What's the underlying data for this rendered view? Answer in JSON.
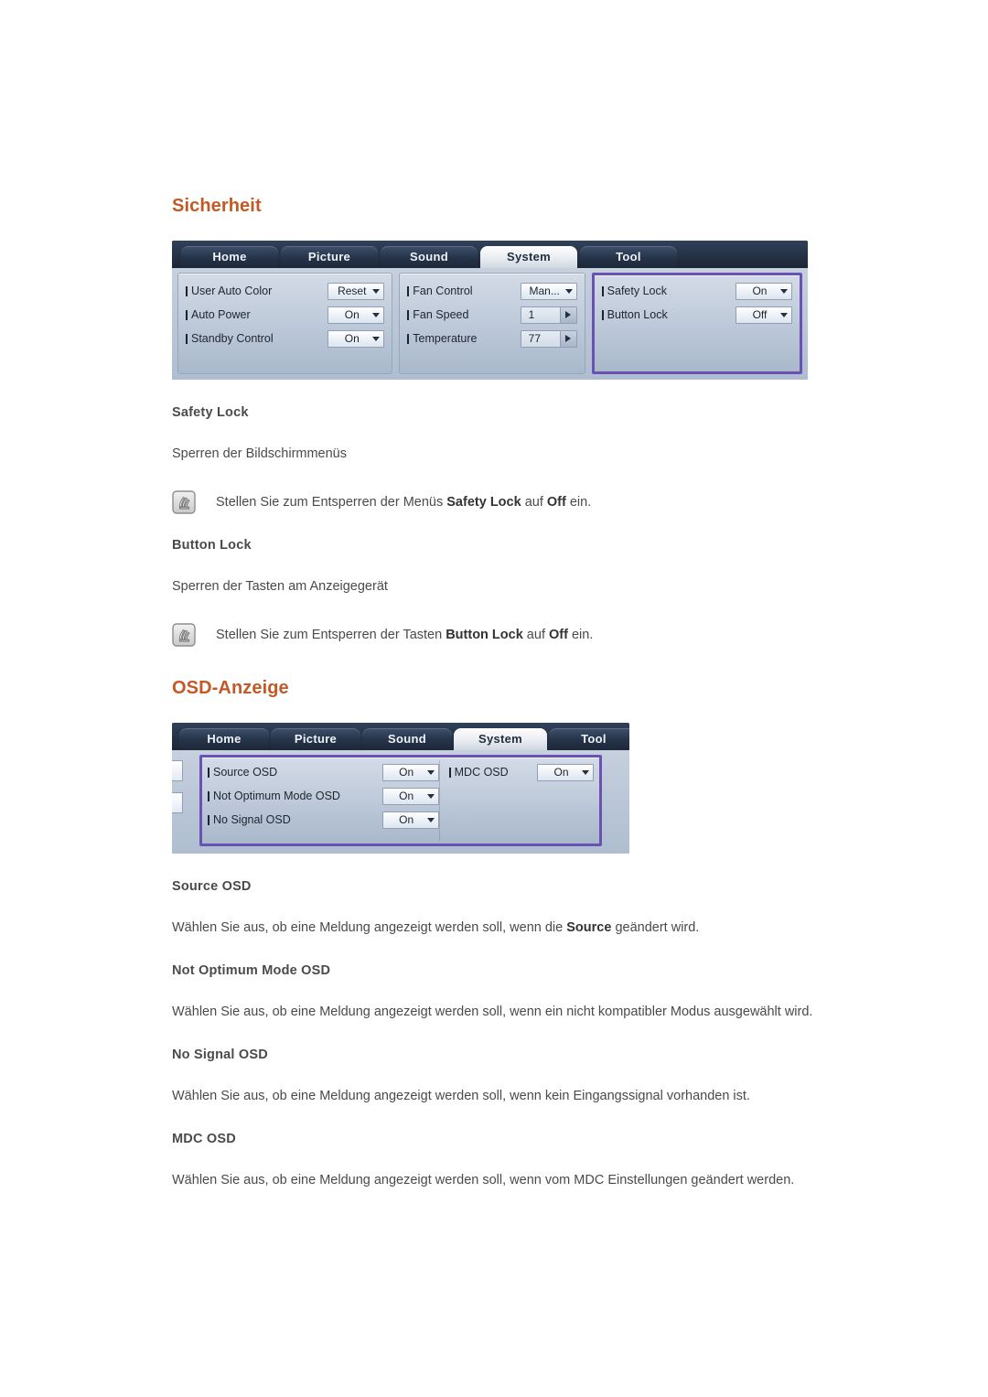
{
  "sections": [
    {
      "id": "sicherheit",
      "title": "Sicherheit",
      "osd": {
        "tabs": [
          {
            "label": "Home",
            "active": false
          },
          {
            "label": "Picture",
            "active": false
          },
          {
            "label": "Sound",
            "active": false
          },
          {
            "label": "System",
            "active": true
          },
          {
            "label": "Tool",
            "active": false
          }
        ],
        "groups": [
          {
            "highlight": false,
            "rows": [
              {
                "label": "User Auto Color",
                "control": "combo",
                "value": "Reset"
              },
              {
                "label": "Auto Power",
                "control": "combo",
                "value": "On"
              },
              {
                "label": "Standby Control",
                "control": "combo",
                "value": "On"
              }
            ]
          },
          {
            "highlight": false,
            "rows": [
              {
                "label": "Fan Control",
                "control": "combo",
                "value": "Man..."
              },
              {
                "label": "Fan Speed",
                "control": "spin",
                "value": "1"
              },
              {
                "label": "Temperature",
                "control": "spin",
                "value": "77"
              }
            ]
          },
          {
            "highlight": true,
            "rows": [
              {
                "label": "Safety Lock",
                "control": "combo",
                "value": "On"
              },
              {
                "label": "Button Lock",
                "control": "combo",
                "value": "Off"
              }
            ]
          }
        ]
      },
      "items": [
        {
          "heading": "Safety Lock",
          "body": "Sperren der Bildschirmmenüs",
          "note": {
            "pre": "Stellen Sie zum Entsperren der Menüs ",
            "bold1": "Safety Lock",
            "mid": " auf ",
            "bold2": "Off",
            "post": " ein."
          }
        },
        {
          "heading": "Button Lock",
          "body": "Sperren der Tasten am Anzeigegerät",
          "note": {
            "pre": "Stellen Sie zum Entsperren der Tasten ",
            "bold1": "Button Lock",
            "mid": " auf ",
            "bold2": "Off",
            "post": " ein."
          }
        }
      ]
    },
    {
      "id": "osd-anzeige",
      "title": "OSD-Anzeige",
      "osd": {
        "tabs": [
          {
            "label": "Home",
            "active": false
          },
          {
            "label": "Picture",
            "active": false
          },
          {
            "label": "Sound",
            "active": false
          },
          {
            "label": "System",
            "active": true
          },
          {
            "label": "Tool",
            "active": false
          }
        ],
        "groups": [
          {
            "highlight": true,
            "rows": [
              {
                "label": "Source OSD",
                "control": "combo",
                "value": "On"
              },
              {
                "label": "Not Optimum Mode OSD",
                "control": "combo",
                "value": "On"
              },
              {
                "label": "No Signal OSD",
                "control": "combo",
                "value": "On"
              }
            ]
          },
          {
            "highlight": false,
            "rows": [
              {
                "label": "MDC OSD",
                "control": "combo",
                "value": "On"
              }
            ]
          }
        ]
      },
      "items": [
        {
          "heading": "Source OSD",
          "body_pre": "Wählen Sie aus, ob eine Meldung angezeigt werden soll, wenn die ",
          "body_bold": "Source",
          "body_post": " geändert wird."
        },
        {
          "heading": "Not Optimum Mode OSD",
          "body": "Wählen Sie aus, ob eine Meldung angezeigt werden soll, wenn ein nicht kompatibler Modus ausgewählt wird."
        },
        {
          "heading": "No Signal OSD",
          "body": "Wählen Sie aus, ob eine Meldung angezeigt werden soll, wenn kein Eingangssignal vorhanden ist."
        },
        {
          "heading": "MDC OSD",
          "body": "Wählen Sie aus, ob eine Meldung angezeigt werden soll, wenn vom MDC Einstellungen geändert werden."
        }
      ]
    }
  ],
  "colors": {
    "heading_accent": "#c35a26",
    "body_text": "#4a4a4a",
    "highlight_border": "#6a52b5"
  }
}
